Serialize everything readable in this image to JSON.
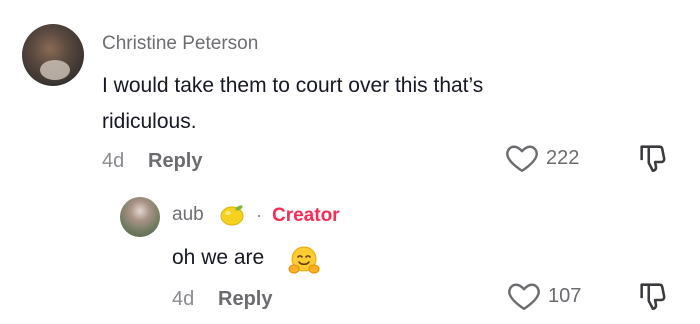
{
  "comment": {
    "username": "Christine Peterson",
    "text_line1": "I would take them to court over this that’s",
    "text_line2": "ridiculous.",
    "age": "4d",
    "reply_label": "Reply",
    "like_count": "222"
  },
  "reply": {
    "username": "aub",
    "separator": "·",
    "creator_label": "Creator",
    "text": "oh we are",
    "age": "4d",
    "reply_label": "Reply",
    "like_count": "107"
  },
  "colors": {
    "creator": "#fe2c55",
    "text": "#161823",
    "muted": "#8a8b91"
  },
  "icons": {
    "like": "heart-outline-icon",
    "dislike": "thumbs-down-icon",
    "lemon": "lemon-emoji-icon",
    "hug": "hugging-face-emoji-icon"
  }
}
